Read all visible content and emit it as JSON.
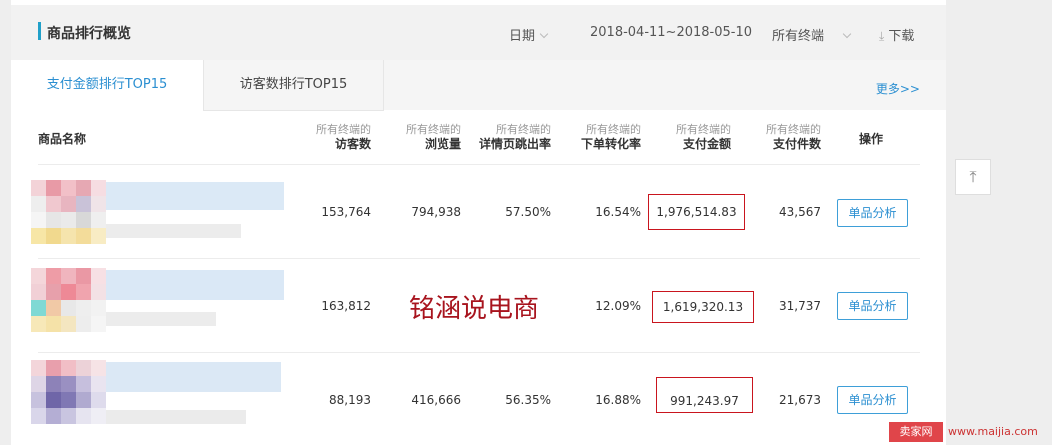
{
  "colors": {
    "accent": "#2b8fd1",
    "highlight_box": "#c9151e",
    "title_bar": "#20a0c9",
    "logo_bg": "#e0454a"
  },
  "header": {
    "title": "商品排行概览",
    "date_label": "日期",
    "date_range": "2018-04-11~2018-05-10",
    "terminal": "所有终端",
    "download": "下载"
  },
  "tabs": [
    {
      "label": "支付金额排行TOP15",
      "active": true
    },
    {
      "label": "访客数排行TOP15",
      "active": false
    }
  ],
  "more": "更多>>",
  "columns": {
    "name": "商品名称",
    "prefix": "所有终端的",
    "visitors": "访客数",
    "pageviews": "浏览量",
    "bounce": "详情页跳出率",
    "conversion": "下单转化率",
    "amount": "支付金额",
    "pieces": "支付件数",
    "op": "操作"
  },
  "rows": [
    {
      "visitors": "153,764",
      "pageviews": "794,938",
      "bounce": "57.50%",
      "conversion": "16.54%",
      "amount": "1,976,514.83",
      "pieces": "43,567",
      "action": "单品分析"
    },
    {
      "visitors": "163,812",
      "pageviews": "",
      "bounce": "",
      "conversion": "12.09%",
      "amount": "1,619,320.13",
      "pieces": "31,737",
      "action": "单品分析"
    },
    {
      "visitors": "88,193",
      "pageviews": "416,666",
      "bounce": "56.35%",
      "conversion": "16.88%",
      "amount": "991,243.97",
      "pieces": "21,673",
      "action": "单品分析"
    }
  ],
  "watermark": "铭涵说电商",
  "scroll_top_icon": "arrow-up-to-top-icon",
  "footer": {
    "logo": "卖家网",
    "site": "www.maijia.com"
  }
}
